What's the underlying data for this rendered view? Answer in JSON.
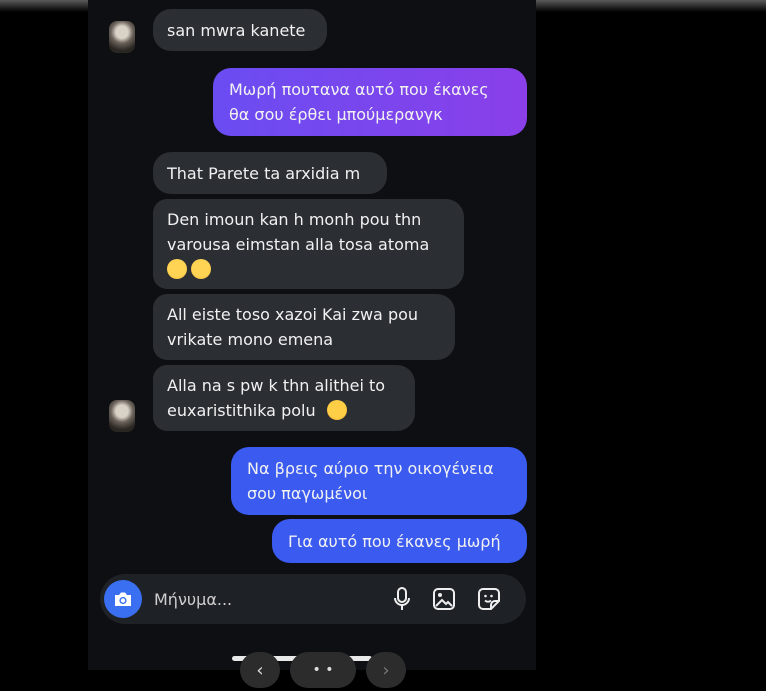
{
  "conversation": {
    "messages": [
      {
        "direction": "incoming",
        "text": "san mwra kanete"
      },
      {
        "direction": "outgoing",
        "line1": "Μωρή πουτανα αυτό που έκανες",
        "line2": "θα σου έρθει μπούμερανγκ"
      },
      {
        "direction": "incoming",
        "text": "That Parete ta arxidia m"
      },
      {
        "direction": "incoming",
        "line1": "Den imoun kan h monh pou thn",
        "line2": "varousa eimstan alla tosa atoma",
        "emoji": "tears-of-joy x2"
      },
      {
        "direction": "incoming",
        "line1": "All eiste toso xazoi Kai zwa pou",
        "line2": "vrikate mono emena"
      },
      {
        "direction": "incoming",
        "line1": "Alla na s pw k thn alithei to",
        "line2": "euxaristithika polu",
        "emoji": "smiling-blush"
      },
      {
        "direction": "outgoing",
        "line1": "Να βρεις αύριο την οικογένεια",
        "line2": "σου παγωμένοι"
      },
      {
        "direction": "outgoing",
        "text": "Για αυτό που έκανες μωρή"
      }
    ]
  },
  "composer": {
    "placeholder": "Μήνυμα...",
    "icons": [
      "camera-icon",
      "microphone-icon",
      "image-icon",
      "sticker-icon"
    ]
  },
  "navigation": {
    "back": "‹",
    "middle": "• •",
    "forward": "›"
  },
  "colors": {
    "incoming_bubble": "#2b2e33",
    "outgoing_bubble": "#3b5bf0",
    "outgoing_purple": "#7a45ee",
    "camera_button": "#3a6ff2"
  }
}
